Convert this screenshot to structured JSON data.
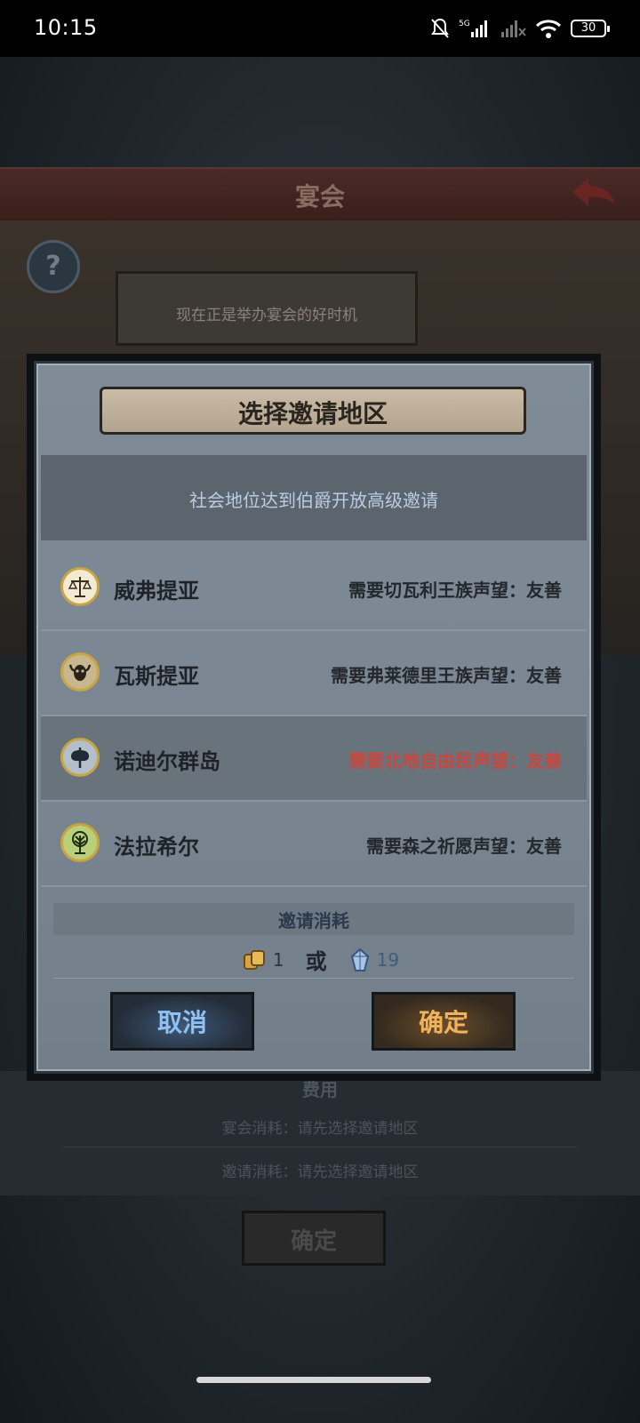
{
  "status_bar": {
    "time": "10:15",
    "network": "5G",
    "battery": "30"
  },
  "background": {
    "header_title": "宴会",
    "banner_text": "现在正是举办宴会的好时机",
    "cost_title": "费用",
    "banquet_cost": "宴会消耗：请先选择邀请地区",
    "invite_cost": "邀请消耗：请先选择邀请地区",
    "confirm_label": "确定"
  },
  "modal": {
    "title": "选择邀请地区",
    "notice": "社会地位达到伯爵开放高级邀请",
    "regions": [
      {
        "name": "威弗提亚",
        "requirement": "需要切瓦利王族声望：友善",
        "locked": false,
        "icon": "scales-icon",
        "icon_bg": "#f2ead2"
      },
      {
        "name": "瓦斯提亚",
        "requirement": "需要弗莱德里王族声望：友善",
        "locked": false,
        "icon": "bull-skull-icon",
        "icon_bg": "#c7b78f"
      },
      {
        "name": "诺迪尔群岛",
        "requirement": "需要北地自由民声望：友善",
        "locked": true,
        "icon": "axe-icon",
        "icon_bg": "#b3c0cc"
      },
      {
        "name": "法拉希尔",
        "requirement": "需要森之祈愿声望：友善",
        "locked": false,
        "icon": "tree-icon",
        "icon_bg": "#b9d07a"
      }
    ],
    "cost": {
      "title": "邀请消耗",
      "item_qty": "1",
      "or_label": "或",
      "gem_qty": "19"
    },
    "cancel_label": "取消",
    "ok_label": "确定"
  }
}
